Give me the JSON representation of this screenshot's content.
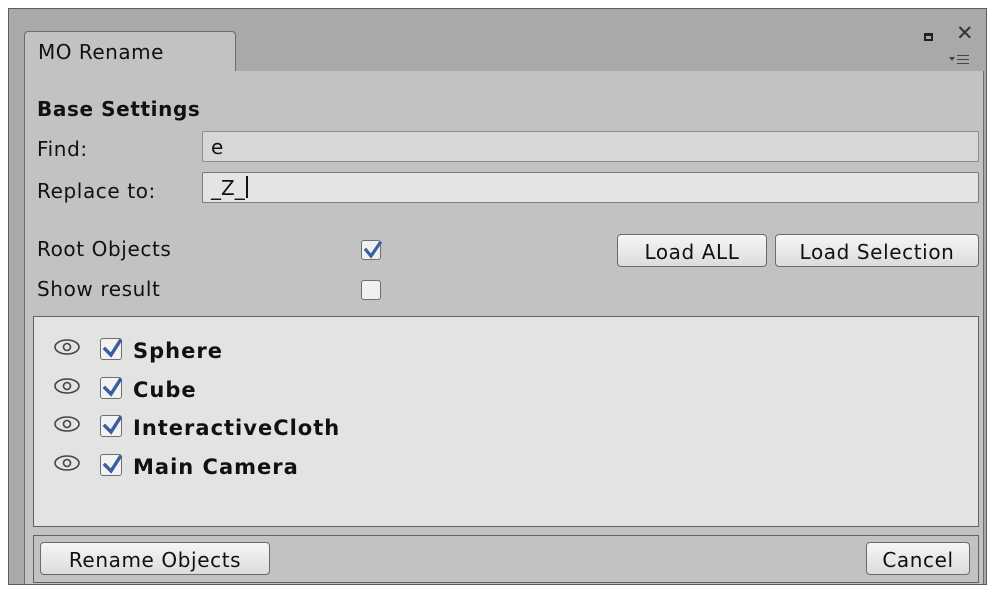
{
  "window": {
    "tab_title": "MO Rename"
  },
  "base_settings": {
    "title": "Base Settings",
    "find_label": "Find:",
    "find_value": "e",
    "replace_label": "Replace to:",
    "replace_value": "_Z_"
  },
  "options": {
    "root_objects_label": "Root Objects",
    "root_objects_checked": true,
    "show_result_label": "Show result",
    "show_result_checked": false,
    "load_all_label": "Load ALL",
    "load_selection_label": "Load Selection"
  },
  "objects": [
    {
      "name": "Sphere",
      "visible": true,
      "checked": true
    },
    {
      "name": "Cube",
      "visible": true,
      "checked": true
    },
    {
      "name": "InteractiveCloth",
      "visible": true,
      "checked": true
    },
    {
      "name": "Main Camera",
      "visible": true,
      "checked": true
    }
  ],
  "footer": {
    "rename_label": "Rename Objects",
    "cancel_label": "Cancel"
  },
  "colors": {
    "checkmark": "#3a5f9e",
    "panel": "#c2c2c2",
    "list_bg": "#e3e3e3"
  }
}
